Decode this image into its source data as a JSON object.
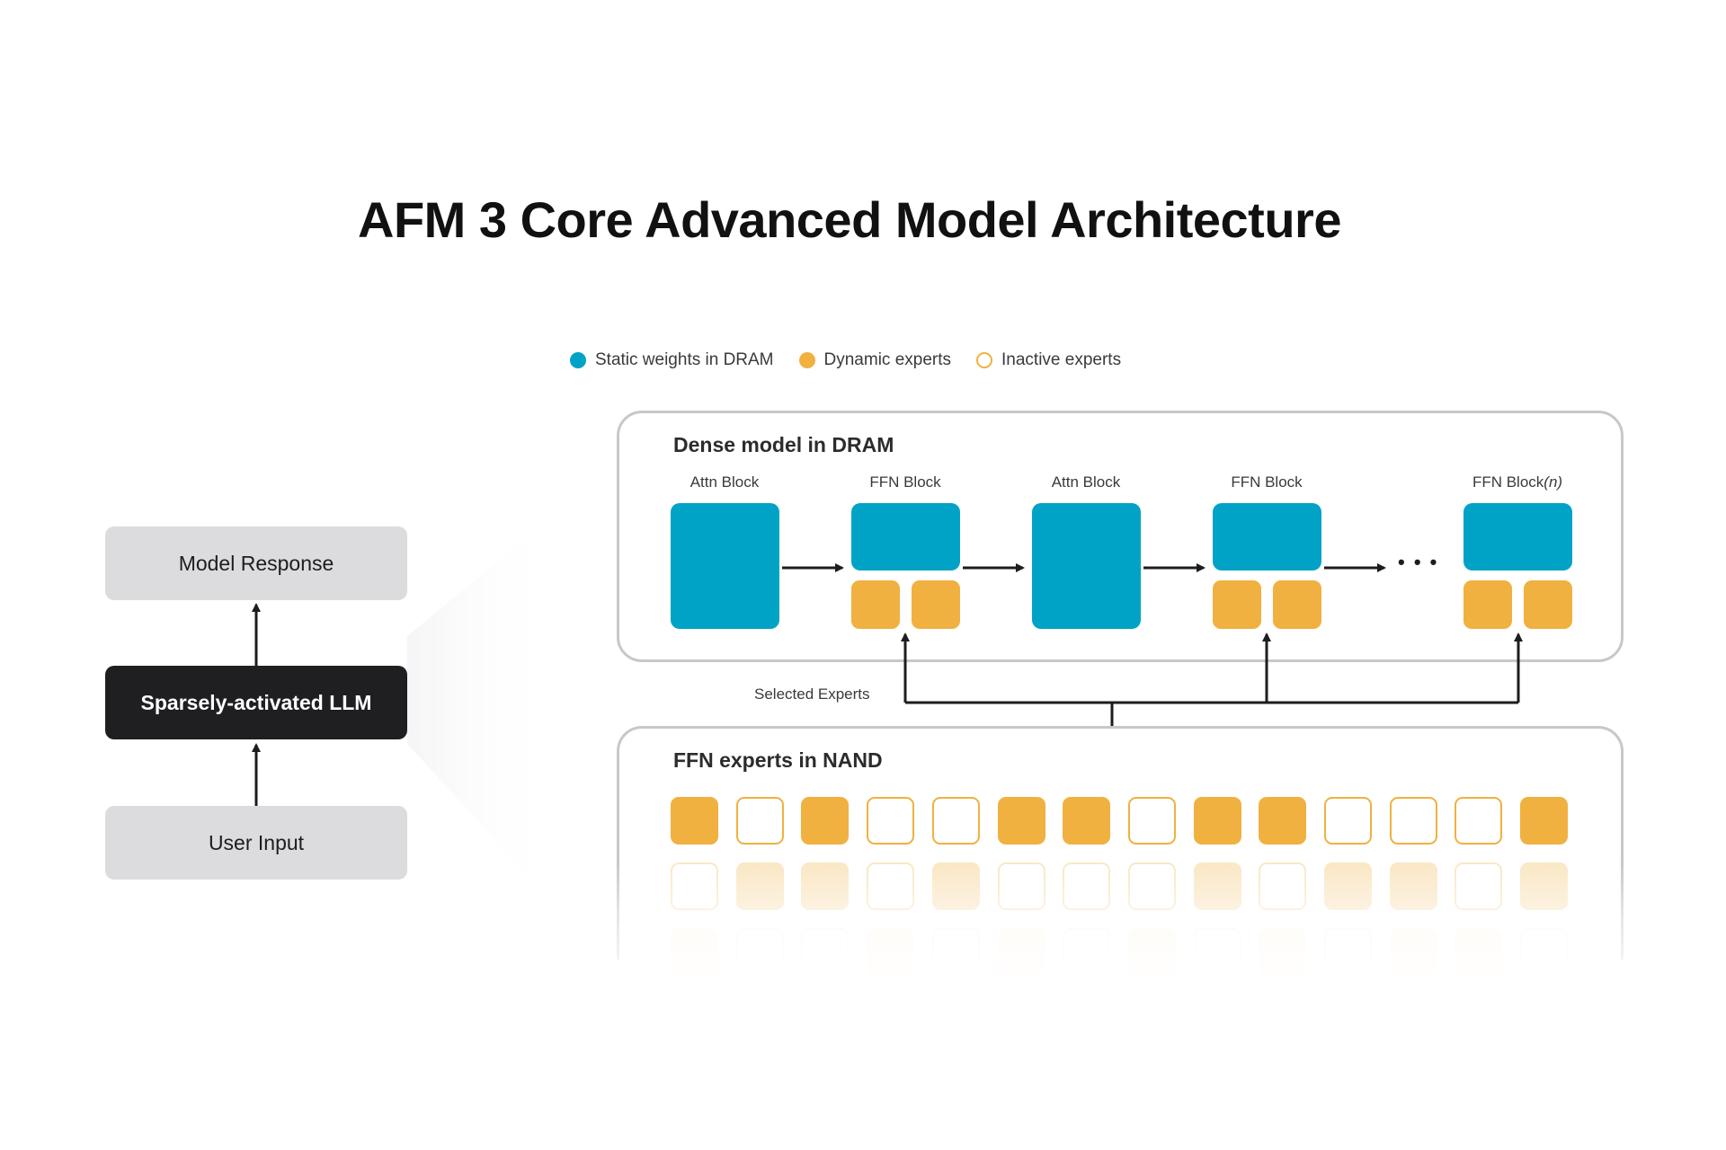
{
  "title": "AFM 3 Core Advanced Model Architecture",
  "legend": [
    {
      "label": "Static weights in DRAM",
      "color": "#00a3c6",
      "filled": true
    },
    {
      "label": "Dynamic experts",
      "color": "#f0b140",
      "filled": true
    },
    {
      "label": "Inactive experts",
      "color": "#f0b140",
      "filled": false
    }
  ],
  "flow": {
    "response": "Model Response",
    "llm": "Sparsely-activated LLM",
    "input": "User Input"
  },
  "dense_panel": {
    "title": "Dense model in DRAM",
    "blocks": [
      {
        "label": "Attn Block",
        "type": "attn"
      },
      {
        "label": "FFN Block",
        "type": "ffn"
      },
      {
        "label": "Attn Block",
        "type": "attn"
      },
      {
        "label": "FFN Block",
        "type": "ffn"
      },
      {
        "label": "FFN Block",
        "label_suffix": "(n)",
        "type": "ffn"
      }
    ],
    "ellipsis": "• • •"
  },
  "selected_label": "Selected Experts",
  "nand_panel": {
    "title": "FFN experts in NAND",
    "row1": [
      1,
      0,
      1,
      0,
      0,
      1,
      1,
      0,
      1,
      1,
      0,
      0,
      0,
      1
    ],
    "row2": [
      0,
      1,
      1,
      0,
      1,
      0,
      0,
      0,
      1,
      0,
      1,
      1,
      0,
      1
    ],
    "row3": [
      1,
      0,
      0,
      1,
      0,
      1,
      0,
      1,
      0,
      1,
      0,
      1,
      1,
      0
    ]
  },
  "colors": {
    "blue": "#00a3c6",
    "orange": "#f0b140",
    "dark": "#1f1f21",
    "light": "#dcdcde"
  }
}
